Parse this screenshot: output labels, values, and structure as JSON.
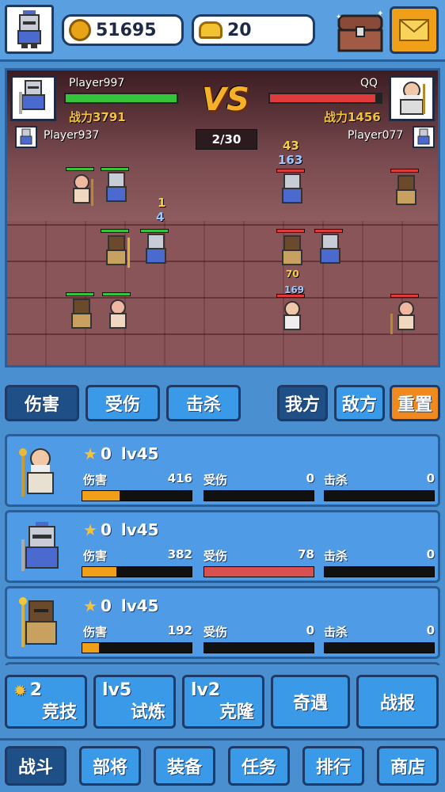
{
  "header": {
    "gold": "51695",
    "ingots": "20"
  },
  "battle": {
    "player_name": "Player997",
    "player_power": "战力3791",
    "player_hp": 1.0,
    "enemy_name": "QQ",
    "enemy_power": "战力1456",
    "enemy_hp": 0.95,
    "vs": "VS",
    "round": "2/30",
    "ally_name": "Player937",
    "enemy_ally_name": "Player077",
    "damage_numbers": [
      "43",
      "163",
      "1",
      "4",
      "70",
      "169"
    ]
  },
  "filters": {
    "damage": "伤害",
    "hurt": "受伤",
    "kills": "击杀",
    "ours": "我方",
    "enemy": "敌方",
    "reset": "重置"
  },
  "heroes": [
    {
      "stars": "0",
      "level": "lv45",
      "damage_label": "伤害",
      "damage": "416",
      "damage_frac": 0.34,
      "hurt_label": "受伤",
      "hurt": "0",
      "hurt_frac": 0,
      "kill_label": "击杀",
      "kills": "0",
      "kill_frac": 0
    },
    {
      "stars": "0",
      "level": "lv45",
      "damage_label": "伤害",
      "damage": "382",
      "damage_frac": 0.31,
      "hurt_label": "受伤",
      "hurt": "78",
      "hurt_frac": 1.0,
      "kill_label": "击杀",
      "kills": "0",
      "kill_frac": 0
    },
    {
      "stars": "0",
      "level": "lv45",
      "damage_label": "伤害",
      "damage": "192",
      "damage_frac": 0.15,
      "hurt_label": "受伤",
      "hurt": "0",
      "hurt_frac": 0,
      "kill_label": "击杀",
      "kills": "0",
      "kill_frac": 0
    }
  ],
  "modes": [
    {
      "top": "2",
      "bottom": "竞技"
    },
    {
      "top": "lv5",
      "bottom": "试炼"
    },
    {
      "top": "lv2",
      "bottom": "克隆"
    },
    {
      "top": "",
      "bottom": "奇遇"
    },
    {
      "top": "",
      "bottom": "战报"
    }
  ],
  "tabs": [
    "战斗",
    "部将",
    "装备",
    "任务",
    "排行",
    "商店"
  ],
  "colors": {
    "ally_hp": "#35c53a",
    "enemy_hp": "#e03a3a",
    "damage_bar": "#f0a018",
    "hurt_bar": "#d85050"
  }
}
